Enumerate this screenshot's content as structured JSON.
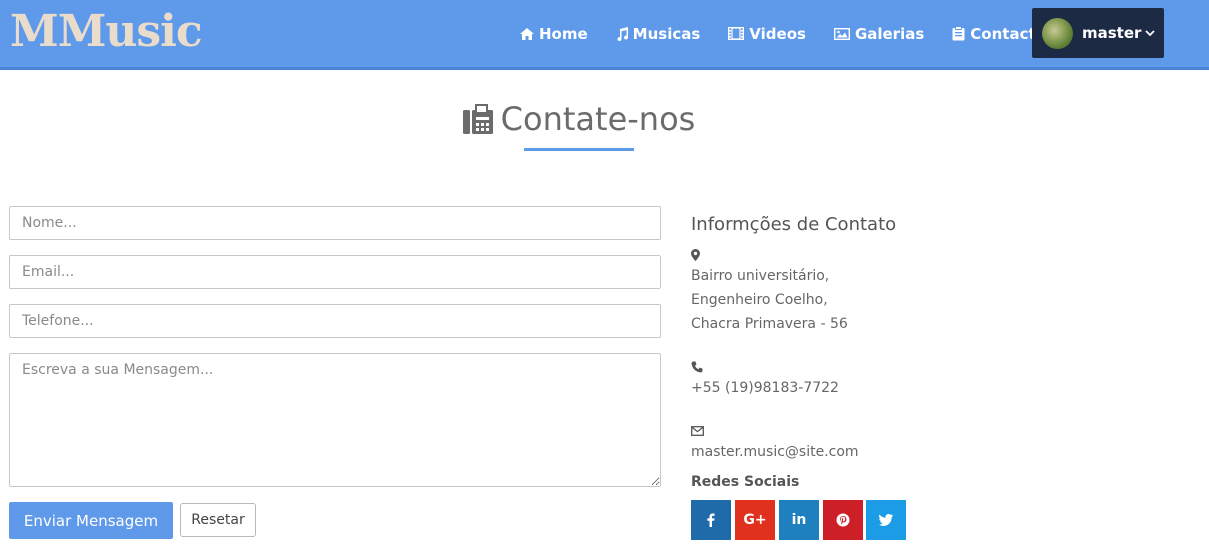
{
  "brand": "MMusic",
  "nav": {
    "items": [
      {
        "label": "Home",
        "icon": "home-icon"
      },
      {
        "label": "Musicas",
        "icon": "music-icon"
      },
      {
        "label": "Videos",
        "icon": "film-icon"
      },
      {
        "label": "Galerias",
        "icon": "image-icon"
      },
      {
        "label": "Contacto",
        "icon": "clipboard-icon"
      }
    ],
    "user": {
      "name": "master",
      "caret": "chevron-down-icon"
    }
  },
  "page": {
    "title": "Contate-nos",
    "title_icon": "fax-icon"
  },
  "form": {
    "name_placeholder": "Nome...",
    "email_placeholder": "Email...",
    "phone_placeholder": "Telefone...",
    "message_placeholder": "Escreva a sua Mensagem...",
    "submit_label": "Enviar Mensagem",
    "reset_label": "Resetar"
  },
  "contact": {
    "title": "Informções de Contato",
    "address": [
      "Bairro universitário,",
      "Engenheiro Coelho,",
      "Chacra Primavera - 56"
    ],
    "phone": "+55 (19)98183-7722",
    "email": "master.music@site.com",
    "social_title": "Redes Sociais",
    "social": [
      {
        "name": "facebook",
        "glyph": "f",
        "color": "#1f6aa8"
      },
      {
        "name": "google-plus",
        "glyph": "G+",
        "color": "#e0301e"
      },
      {
        "name": "linkedin",
        "glyph": "in",
        "color": "#1f80c0"
      },
      {
        "name": "pinterest",
        "glyph": "P",
        "color": "#cc1f27"
      },
      {
        "name": "twitter",
        "glyph": "t",
        "color": "#1c9ce6"
      }
    ]
  },
  "colors": {
    "navbar": "#5f9aea",
    "user_box": "#1d2a44",
    "brand": "#e9dccb"
  }
}
